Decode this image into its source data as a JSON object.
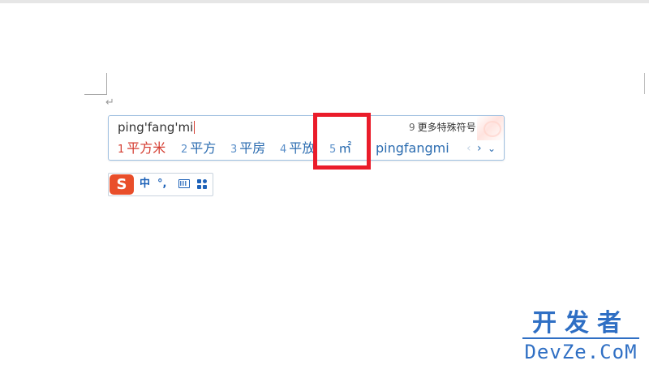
{
  "document": {
    "paragraph_mark": "↵"
  },
  "ime": {
    "composition": "ping'fang'mi",
    "more_symbols": {
      "index": "9",
      "label": "更多特殊符号"
    },
    "candidates": [
      {
        "index": "1",
        "text": "平方米",
        "selected": true
      },
      {
        "index": "2",
        "text": "平方",
        "selected": false
      },
      {
        "index": "3",
        "text": "平房",
        "selected": false
      },
      {
        "index": "4",
        "text": "平放",
        "selected": false
      },
      {
        "index": "5",
        "text": "㎡",
        "selected": false
      },
      {
        "index": "",
        "text": "pingfangmi",
        "selected": false
      }
    ],
    "nav": {
      "prev": "‹",
      "next": "›",
      "expand": "⌄"
    }
  },
  "status_bar": {
    "logo": "S",
    "mode": "中",
    "punctuation": "°,",
    "icons": [
      "keyboard-icon",
      "toolbox-icon"
    ]
  },
  "watermark": {
    "cn": "开发者",
    "en": "DevZe.CoM"
  },
  "colors": {
    "highlight": "#ea1c2a",
    "selected_candidate": "#d43b2f",
    "candidate": "#2b6cb0",
    "logo_bg": "#e94e2a",
    "watermark": "#2f6fc4"
  }
}
